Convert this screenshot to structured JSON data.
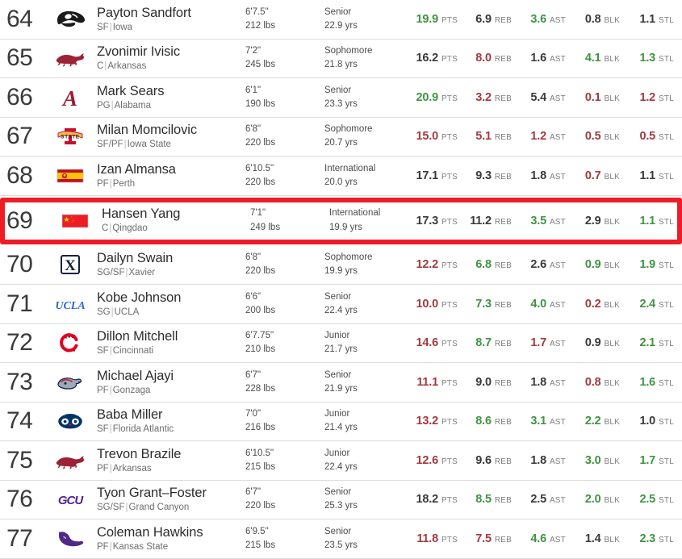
{
  "stat_columns": [
    "PTS",
    "REB",
    "AST",
    "BLK",
    "STL"
  ],
  "colors": {
    "good": "#3f9442",
    "bad": "#a33a3f",
    "neutral": "#3a3a3a",
    "highlight_border": "#ee1c25",
    "row_divider": "#dcdcdc"
  },
  "rows": [
    {
      "rank": "64",
      "logo": "iowa-hawkeyes-logo",
      "name": "Payton Sandfort",
      "position": "SF",
      "school": "Iowa",
      "height": "6'7.5\"",
      "weight": "212 lbs",
      "class": "Senior",
      "age": "22.9 yrs",
      "highlighted": false,
      "stats": [
        {
          "value": "19.9",
          "label": "PTS",
          "tone": "good"
        },
        {
          "value": "6.9",
          "label": "REB",
          "tone": "neutral"
        },
        {
          "value": "3.6",
          "label": "AST",
          "tone": "good"
        },
        {
          "value": "0.8",
          "label": "BLK",
          "tone": "neutral"
        },
        {
          "value": "1.1",
          "label": "STL",
          "tone": "neutral"
        }
      ]
    },
    {
      "rank": "65",
      "logo": "arkansas-razorbacks-logo",
      "name": "Zvonimir Ivisic",
      "position": "C",
      "school": "Arkansas",
      "height": "7'2\"",
      "weight": "245 lbs",
      "class": "Sophomore",
      "age": "21.8 yrs",
      "highlighted": false,
      "stats": [
        {
          "value": "16.2",
          "label": "PTS",
          "tone": "neutral"
        },
        {
          "value": "8.0",
          "label": "REB",
          "tone": "bad"
        },
        {
          "value": "1.6",
          "label": "AST",
          "tone": "neutral"
        },
        {
          "value": "4.1",
          "label": "BLK",
          "tone": "good"
        },
        {
          "value": "1.3",
          "label": "STL",
          "tone": "good"
        }
      ]
    },
    {
      "rank": "66",
      "logo": "alabama-crimson-tide-logo",
      "name": "Mark Sears",
      "position": "PG",
      "school": "Alabama",
      "height": "6'1\"",
      "weight": "190 lbs",
      "class": "Senior",
      "age": "23.3 yrs",
      "highlighted": false,
      "stats": [
        {
          "value": "20.9",
          "label": "PTS",
          "tone": "good"
        },
        {
          "value": "3.2",
          "label": "REB",
          "tone": "bad"
        },
        {
          "value": "5.4",
          "label": "AST",
          "tone": "neutral"
        },
        {
          "value": "0.1",
          "label": "BLK",
          "tone": "bad"
        },
        {
          "value": "1.2",
          "label": "STL",
          "tone": "bad"
        }
      ]
    },
    {
      "rank": "67",
      "logo": "iowa-state-cyclones-logo",
      "name": "Milan Momcilovic",
      "position": "SF/PF",
      "school": "Iowa State",
      "height": "6'8\"",
      "weight": "220 lbs",
      "class": "Sophomore",
      "age": "20.7 yrs",
      "highlighted": false,
      "stats": [
        {
          "value": "15.0",
          "label": "PTS",
          "tone": "bad"
        },
        {
          "value": "5.1",
          "label": "REB",
          "tone": "bad"
        },
        {
          "value": "1.2",
          "label": "AST",
          "tone": "bad"
        },
        {
          "value": "0.5",
          "label": "BLK",
          "tone": "bad"
        },
        {
          "value": "0.5",
          "label": "STL",
          "tone": "bad"
        }
      ]
    },
    {
      "rank": "68",
      "logo": "spain-flag-icon",
      "name": "Izan Almansa",
      "position": "PF",
      "school": "Perth",
      "height": "6'10.5\"",
      "weight": "220 lbs",
      "class": "International",
      "age": "20.0 yrs",
      "highlighted": false,
      "stats": [
        {
          "value": "17.1",
          "label": "PTS",
          "tone": "neutral"
        },
        {
          "value": "9.3",
          "label": "REB",
          "tone": "neutral"
        },
        {
          "value": "1.8",
          "label": "AST",
          "tone": "neutral"
        },
        {
          "value": "0.7",
          "label": "BLK",
          "tone": "bad"
        },
        {
          "value": "1.1",
          "label": "STL",
          "tone": "neutral"
        }
      ]
    },
    {
      "rank": "69",
      "logo": "china-flag-icon",
      "name": "Hansen Yang",
      "position": "C",
      "school": "Qingdao",
      "height": "7'1\"",
      "weight": "249 lbs",
      "class": "International",
      "age": "19.9 yrs",
      "highlighted": true,
      "stats": [
        {
          "value": "17.3",
          "label": "PTS",
          "tone": "neutral"
        },
        {
          "value": "11.2",
          "label": "REB",
          "tone": "neutral"
        },
        {
          "value": "3.5",
          "label": "AST",
          "tone": "good"
        },
        {
          "value": "2.9",
          "label": "BLK",
          "tone": "neutral"
        },
        {
          "value": "1.1",
          "label": "STL",
          "tone": "good"
        }
      ]
    },
    {
      "rank": "70",
      "logo": "xavier-musketeers-logo",
      "name": "Dailyn Swain",
      "position": "SG/SF",
      "school": "Xavier",
      "height": "6'8\"",
      "weight": "220 lbs",
      "class": "Sophomore",
      "age": "19.9 yrs",
      "highlighted": false,
      "stats": [
        {
          "value": "12.2",
          "label": "PTS",
          "tone": "bad"
        },
        {
          "value": "6.8",
          "label": "REB",
          "tone": "good"
        },
        {
          "value": "2.6",
          "label": "AST",
          "tone": "neutral"
        },
        {
          "value": "0.9",
          "label": "BLK",
          "tone": "good"
        },
        {
          "value": "1.9",
          "label": "STL",
          "tone": "good"
        }
      ]
    },
    {
      "rank": "71",
      "logo": "ucla-bruins-logo",
      "name": "Kobe Johnson",
      "position": "SG",
      "school": "UCLA",
      "height": "6'6\"",
      "weight": "200 lbs",
      "class": "Senior",
      "age": "22.4 yrs",
      "highlighted": false,
      "stats": [
        {
          "value": "10.0",
          "label": "PTS",
          "tone": "bad"
        },
        {
          "value": "7.3",
          "label": "REB",
          "tone": "good"
        },
        {
          "value": "4.0",
          "label": "AST",
          "tone": "good"
        },
        {
          "value": "0.2",
          "label": "BLK",
          "tone": "bad"
        },
        {
          "value": "2.4",
          "label": "STL",
          "tone": "good"
        }
      ]
    },
    {
      "rank": "72",
      "logo": "cincinnati-bearcats-logo",
      "name": "Dillon Mitchell",
      "position": "SF",
      "school": "Cincinnati",
      "height": "6'7.75\"",
      "weight": "210 lbs",
      "class": "Junior",
      "age": "21.7 yrs",
      "highlighted": false,
      "stats": [
        {
          "value": "14.6",
          "label": "PTS",
          "tone": "bad"
        },
        {
          "value": "8.7",
          "label": "REB",
          "tone": "good"
        },
        {
          "value": "1.7",
          "label": "AST",
          "tone": "bad"
        },
        {
          "value": "0.9",
          "label": "BLK",
          "tone": "neutral"
        },
        {
          "value": "2.1",
          "label": "STL",
          "tone": "good"
        }
      ]
    },
    {
      "rank": "73",
      "logo": "gonzaga-bulldogs-logo",
      "name": "Michael Ajayi",
      "position": "PF",
      "school": "Gonzaga",
      "height": "6'7\"",
      "weight": "228 lbs",
      "class": "Senior",
      "age": "21.9 yrs",
      "highlighted": false,
      "stats": [
        {
          "value": "11.1",
          "label": "PTS",
          "tone": "bad"
        },
        {
          "value": "9.0",
          "label": "REB",
          "tone": "neutral"
        },
        {
          "value": "1.8",
          "label": "AST",
          "tone": "neutral"
        },
        {
          "value": "0.8",
          "label": "BLK",
          "tone": "bad"
        },
        {
          "value": "1.6",
          "label": "STL",
          "tone": "good"
        }
      ]
    },
    {
      "rank": "74",
      "logo": "florida-atlantic-owls-logo",
      "name": "Baba Miller",
      "position": "SF",
      "school": "Florida Atlantic",
      "height": "7'0\"",
      "weight": "216 lbs",
      "class": "Junior",
      "age": "21.4 yrs",
      "highlighted": false,
      "stats": [
        {
          "value": "13.2",
          "label": "PTS",
          "tone": "bad"
        },
        {
          "value": "8.6",
          "label": "REB",
          "tone": "good"
        },
        {
          "value": "3.1",
          "label": "AST",
          "tone": "good"
        },
        {
          "value": "2.2",
          "label": "BLK",
          "tone": "good"
        },
        {
          "value": "1.0",
          "label": "STL",
          "tone": "neutral"
        }
      ]
    },
    {
      "rank": "75",
      "logo": "arkansas-razorbacks-logo",
      "name": "Trevon Brazile",
      "position": "PF",
      "school": "Arkansas",
      "height": "6'10.5\"",
      "weight": "215 lbs",
      "class": "Junior",
      "age": "22.4 yrs",
      "highlighted": false,
      "stats": [
        {
          "value": "12.6",
          "label": "PTS",
          "tone": "bad"
        },
        {
          "value": "9.6",
          "label": "REB",
          "tone": "neutral"
        },
        {
          "value": "1.8",
          "label": "AST",
          "tone": "neutral"
        },
        {
          "value": "3.0",
          "label": "BLK",
          "tone": "good"
        },
        {
          "value": "1.7",
          "label": "STL",
          "tone": "good"
        }
      ]
    },
    {
      "rank": "76",
      "logo": "grand-canyon-antelopes-logo",
      "name": "Tyon Grant–Foster",
      "position": "SG/SF",
      "school": "Grand Canyon",
      "height": "6'7\"",
      "weight": "220 lbs",
      "class": "Senior",
      "age": "25.3 yrs",
      "highlighted": false,
      "stats": [
        {
          "value": "18.2",
          "label": "PTS",
          "tone": "neutral"
        },
        {
          "value": "8.5",
          "label": "REB",
          "tone": "good"
        },
        {
          "value": "2.5",
          "label": "AST",
          "tone": "neutral"
        },
        {
          "value": "2.0",
          "label": "BLK",
          "tone": "good"
        },
        {
          "value": "2.5",
          "label": "STL",
          "tone": "good"
        }
      ]
    },
    {
      "rank": "77",
      "logo": "kansas-state-wildcats-logo",
      "name": "Coleman Hawkins",
      "position": "PF",
      "school": "Kansas State",
      "height": "6'9.5\"",
      "weight": "215 lbs",
      "class": "Senior",
      "age": "23.5 yrs",
      "highlighted": false,
      "stats": [
        {
          "value": "11.8",
          "label": "PTS",
          "tone": "bad"
        },
        {
          "value": "7.5",
          "label": "REB",
          "tone": "bad"
        },
        {
          "value": "4.6",
          "label": "AST",
          "tone": "good"
        },
        {
          "value": "1.4",
          "label": "BLK",
          "tone": "neutral"
        },
        {
          "value": "2.3",
          "label": "STL",
          "tone": "good"
        }
      ]
    }
  ]
}
